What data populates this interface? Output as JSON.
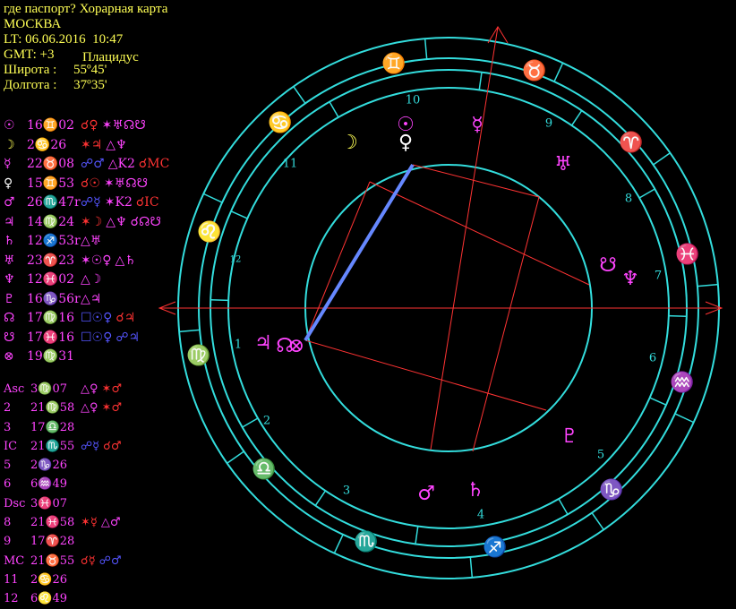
{
  "header": {
    "title": "где паспорт? Хорарная карта",
    "city": "МОСКВА",
    "local_time": "LT: 06.06.2016  10:47",
    "gmt": "GMT: +3",
    "house_system": "Плацидус",
    "latitude_label": "Широта :",
    "latitude_value": "55º45'",
    "longitude_label": "Долгота :",
    "longitude_value": "37º35'"
  },
  "colors": {
    "yellow": "#ffff55",
    "magenta": "#ff44ff",
    "red": "#ff3333",
    "blue": "#5555ff",
    "cyan": "#33dddd",
    "white": "#ffffff"
  },
  "positions": [
    {
      "glyph": "☉",
      "color": "#ff44ff",
      "value": "16♊02",
      "aspects": [
        {
          "t": "☌♀",
          "c": "#ff3333"
        },
        {
          "t": "✶♅☊☋",
          "c": "#ff44ff"
        }
      ]
    },
    {
      "glyph": "☽",
      "color": "#ffff55",
      "value": "2♋26",
      "aspects": [
        {
          "t": "✶♃",
          "c": "#ff3333"
        },
        {
          "t": "△♆",
          "c": "#ff44ff"
        }
      ]
    },
    {
      "glyph": "☿",
      "color": "#ff44ff",
      "value": "22♉08",
      "aspects": [
        {
          "t": "☍♂",
          "c": "#5555ff"
        },
        {
          "t": "△K2",
          "c": "#ff44ff"
        },
        {
          "t": "☌MC",
          "c": "#ff3333"
        }
      ]
    },
    {
      "glyph": "♀",
      "color": "#ffffff",
      "value": "15♊53",
      "aspects": [
        {
          "t": "☌☉",
          "c": "#ff3333"
        },
        {
          "t": "✶♅☊☋",
          "c": "#ff44ff"
        }
      ]
    },
    {
      "glyph": "♂",
      "color": "#ff44ff",
      "value": "26♏47r",
      "aspects": [
        {
          "t": "☍☿",
          "c": "#5555ff"
        },
        {
          "t": "✶K2",
          "c": "#ff44ff"
        },
        {
          "t": "☌IC",
          "c": "#ff3333"
        }
      ]
    },
    {
      "glyph": "♃",
      "color": "#ff44ff",
      "value": "14♍24",
      "aspects": [
        {
          "t": "✶☽",
          "c": "#ff3333"
        },
        {
          "t": "△♆",
          "c": "#ff44ff"
        },
        {
          "t": "☌☊☋",
          "c": "#ff44ff"
        }
      ]
    },
    {
      "glyph": "♄",
      "color": "#ff44ff",
      "value": "12♐53r",
      "aspects": [
        {
          "t": "△♅",
          "c": "#ff44ff"
        }
      ]
    },
    {
      "glyph": "♅",
      "color": "#ff44ff",
      "value": "23♈23",
      "aspects": [
        {
          "t": "✶☉♀",
          "c": "#ff44ff"
        },
        {
          "t": "△♄",
          "c": "#ff44ff"
        }
      ]
    },
    {
      "glyph": "♆",
      "color": "#ff44ff",
      "value": "12♓02",
      "aspects": [
        {
          "t": "△☽",
          "c": "#ff44ff"
        }
      ]
    },
    {
      "glyph": "♇",
      "color": "#ff44ff",
      "value": "16♑56r",
      "aspects": [
        {
          "t": "△♃",
          "c": "#ff44ff"
        }
      ]
    },
    {
      "glyph": "☊",
      "color": "#ff44ff",
      "value": "17♍16",
      "aspects": [
        {
          "t": "☐☉♀",
          "c": "#5555ff"
        },
        {
          "t": "☌♃",
          "c": "#ff3333"
        }
      ]
    },
    {
      "glyph": "☋",
      "color": "#ff44ff",
      "value": "17♓16",
      "aspects": [
        {
          "t": "☐☉♀",
          "c": "#5555ff"
        },
        {
          "t": "☍♃",
          "c": "#5555ff"
        }
      ]
    },
    {
      "glyph": "⊗",
      "color": "#ff44ff",
      "value": "19♍31",
      "aspects": []
    }
  ],
  "cusps": [
    {
      "label": "Asc",
      "value": "3♍07",
      "aspects": [
        {
          "t": "△♀",
          "c": "#ff44ff"
        },
        {
          "t": "✶♂",
          "c": "#ff3333"
        }
      ]
    },
    {
      "label": "2",
      "value": "21♍58",
      "aspects": [
        {
          "t": "△♀",
          "c": "#ff44ff"
        },
        {
          "t": "✶♂",
          "c": "#ff3333"
        }
      ]
    },
    {
      "label": "3",
      "value": "17♎28",
      "aspects": []
    },
    {
      "label": "IC",
      "value": "21♏55",
      "aspects": [
        {
          "t": "☍☿",
          "c": "#5555ff"
        },
        {
          "t": "☌♂",
          "c": "#ff3333"
        }
      ]
    },
    {
      "label": "5",
      "value": "2♑26",
      "aspects": []
    },
    {
      "label": "6",
      "value": "6♒49",
      "aspects": []
    },
    {
      "label": "Dsc",
      "value": "3♓07",
      "aspects": []
    },
    {
      "label": "8",
      "value": "21♓58",
      "aspects": [
        {
          "t": "✶☿",
          "c": "#ff3333"
        },
        {
          "t": "△♂",
          "c": "#ff44ff"
        }
      ]
    },
    {
      "label": "9",
      "value": "17♈28",
      "aspects": []
    },
    {
      "label": "MC",
      "value": "21♉55",
      "aspects": [
        {
          "t": "☌☿",
          "c": "#ff3333"
        },
        {
          "t": "☍♂",
          "c": "#5555ff"
        }
      ]
    },
    {
      "label": "11",
      "value": "2♋26",
      "aspects": []
    },
    {
      "label": "12",
      "value": "6♌49",
      "aspects": []
    }
  ],
  "wheel": {
    "signs": [
      {
        "g": "♊",
        "c": "#ffff55"
      },
      {
        "g": "♉",
        "c": "#ffff55"
      },
      {
        "g": "♈",
        "c": "#ffff55"
      },
      {
        "g": "♓",
        "c": "#ffff55"
      },
      {
        "g": "♒",
        "c": "#ffff55"
      },
      {
        "g": "♑",
        "c": "#ffff55"
      },
      {
        "g": "♐",
        "c": "#ffff55"
      },
      {
        "g": "♏",
        "c": "#ffff55"
      },
      {
        "g": "♎",
        "c": "#ffff55"
      },
      {
        "g": "♍",
        "c": "#ffff55"
      },
      {
        "g": "♌",
        "c": "#ffff55"
      },
      {
        "g": "♋",
        "c": "#ffff55"
      }
    ],
    "house_numbers": [
      "1",
      "2",
      "3",
      "4",
      "5",
      "6",
      "7",
      "8",
      "9",
      "10",
      "11",
      "12"
    ],
    "planets": [
      {
        "g": "☉",
        "c": "#ff44ff"
      },
      {
        "g": "♀",
        "c": "#ffffff"
      },
      {
        "g": "☿",
        "c": "#ff44ff"
      },
      {
        "g": "☽",
        "c": "#ffff55"
      },
      {
        "g": "♅",
        "c": "#ff44ff"
      },
      {
        "g": "☋",
        "c": "#ff44ff"
      },
      {
        "g": "♆",
        "c": "#ff44ff"
      },
      {
        "g": "♇",
        "c": "#ff44ff"
      },
      {
        "g": "♂",
        "c": "#ff44ff"
      },
      {
        "g": "♄",
        "c": "#ff44ff"
      },
      {
        "g": "♃",
        "c": "#ff44ff"
      },
      {
        "g": "☊",
        "c": "#ff44ff"
      },
      {
        "g": "⊗",
        "c": "#ff44ff"
      }
    ]
  }
}
